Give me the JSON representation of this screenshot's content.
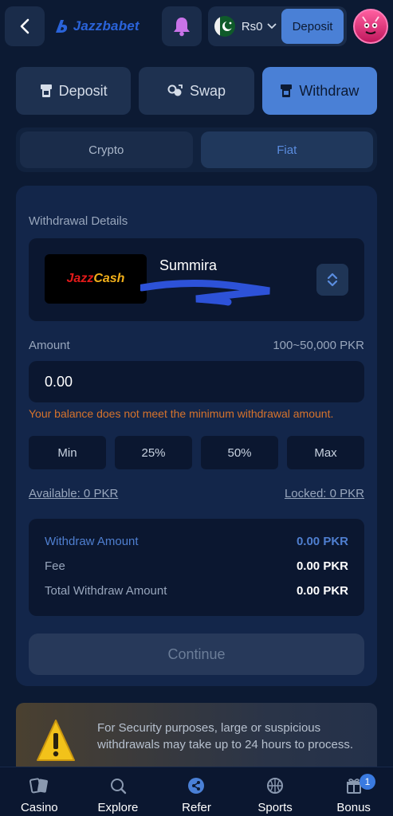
{
  "header": {
    "brand": "Jazzbabet",
    "balance": "Rs0",
    "deposit_label": "Deposit"
  },
  "main_tabs": [
    {
      "label": "Deposit",
      "icon": "atm-icon",
      "active": false
    },
    {
      "label": "Swap",
      "icon": "swap-icon",
      "active": false
    },
    {
      "label": "Withdraw",
      "icon": "atm-icon",
      "active": true
    }
  ],
  "sub_tabs": [
    {
      "label": "Crypto",
      "active": false
    },
    {
      "label": "Fiat",
      "active": true
    }
  ],
  "withdrawal": {
    "section_label": "Withdrawal Details",
    "method_brand_1": "Jazz",
    "method_brand_2": "Cash",
    "account_name": "Summira",
    "amount_label": "Amount",
    "amount_range": "100~50,000 PKR",
    "amount_value": "0.00",
    "error_message": "Your balance does not meet the minimum withdrawal amount.",
    "quick_amounts": [
      "Min",
      "25%",
      "50%",
      "Max"
    ],
    "available": "Available: 0 PKR",
    "locked": "Locked: 0 PKR",
    "summary": [
      {
        "label": "Withdraw Amount",
        "value": "0.00 PKR"
      },
      {
        "label": "Fee",
        "value": "0.00 PKR"
      },
      {
        "label": "Total Withdraw Amount",
        "value": "0.00 PKR"
      }
    ],
    "continue_label": "Continue"
  },
  "notice": {
    "text": "For Security purposes, large or suspicious withdrawals may take up to 24 hours to process."
  },
  "bottom_nav": [
    {
      "label": "Casino",
      "icon": "cards-icon"
    },
    {
      "label": "Explore",
      "icon": "explore-icon"
    },
    {
      "label": "Refer",
      "icon": "share-icon"
    },
    {
      "label": "Sports",
      "icon": "basketball-icon"
    },
    {
      "label": "Bonus",
      "icon": "gift-icon",
      "badge": "1"
    }
  ],
  "colors": {
    "background": "#0c1a33",
    "accent": "#4a80d6",
    "error": "#d6732c"
  }
}
